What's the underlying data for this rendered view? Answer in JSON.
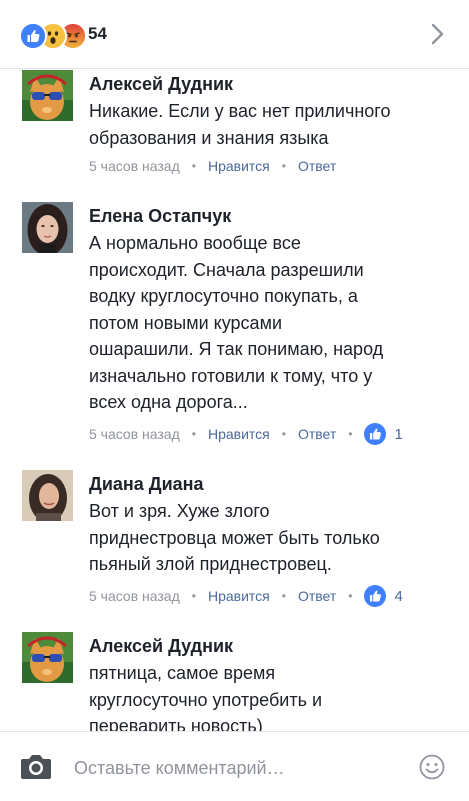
{
  "header": {
    "reactions": [
      "like",
      "wow",
      "angry"
    ],
    "reaction_count": "54"
  },
  "comments": [
    {
      "author": "Алексей Дудник",
      "text": "Никакие. Если у вас нет приличного\nобразования и знания языка",
      "time": "5 часов назад",
      "like_label": "Нравится",
      "reply_label": "Ответ",
      "likes": ""
    },
    {
      "author": "Елена Остапчук",
      "text": "А нормально вообще все\nпроисходит. Сначала разрешили\nводку круглосуточно покупать, а\nпотом новыми курсами\nошарашили. Я так понимаю, народ\nизначально готовили к тому, что у\nвсех одна дорога...",
      "time": "5 часов назад",
      "like_label": "Нравится",
      "reply_label": "Ответ",
      "likes": "1"
    },
    {
      "author": "Диана Диана",
      "text": "Вот и зря. Хуже злого\nприднестровца может быть только\nпьяный злой приднестровец.",
      "time": "5 часов назад",
      "like_label": "Нравится",
      "reply_label": "Ответ",
      "likes": "4"
    },
    {
      "author": "Алексей Дудник",
      "text": "пятница, самое время\nкруглосуточно употребить и\nпереварить новость)",
      "time": "",
      "like_label": "",
      "reply_label": "",
      "likes": ""
    }
  ],
  "composer": {
    "placeholder": "Оставьте комментарий…"
  },
  "colors": {
    "link": "#4b6a9a",
    "meta": "#90949c",
    "like_blue": "#4080ff",
    "text": "#1d2129"
  },
  "icons": [
    "like-reaction-icon",
    "wow-reaction-icon",
    "angry-reaction-icon",
    "chevron-right-icon",
    "like-badge-icon",
    "camera-icon",
    "smiley-icon"
  ]
}
